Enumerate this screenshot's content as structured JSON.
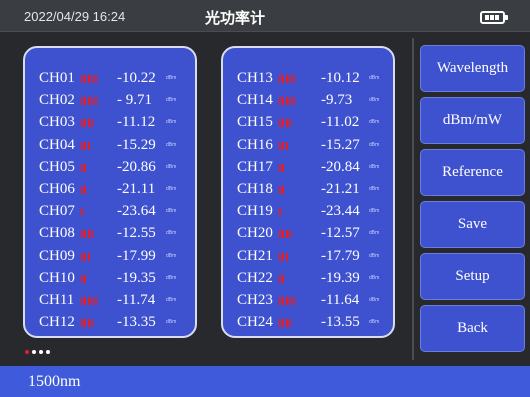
{
  "header": {
    "datetime": "2022/04/29  16:24",
    "title": "光功率计",
    "battery_icon": "battery-full-icon"
  },
  "channels": [
    {
      "name": "CH01",
      "value": "-10.22",
      "unit": "dBm",
      "level": 5
    },
    {
      "name": "CH02",
      "value": "- 9.71",
      "unit": "dBm",
      "level": 5
    },
    {
      "name": "CH03",
      "value": "-11.12",
      "unit": "dBm",
      "level": 4
    },
    {
      "name": "CH04",
      "value": "-15.29",
      "unit": "dBm",
      "level": 3
    },
    {
      "name": "CH05",
      "value": "-20.86",
      "unit": "dBm",
      "level": 2
    },
    {
      "name": "CH06",
      "value": "-21.11",
      "unit": "dBm",
      "level": 2
    },
    {
      "name": "CH07",
      "value": "-23.64",
      "unit": "dBm",
      "level": 1
    },
    {
      "name": "CH08",
      "value": "-12.55",
      "unit": "dBm",
      "level": 4
    },
    {
      "name": "CH09",
      "value": "-17.99",
      "unit": "dBm",
      "level": 3
    },
    {
      "name": "CH10",
      "value": "-19.35",
      "unit": "dBm",
      "level": 2
    },
    {
      "name": "CH11",
      "value": "-11.74",
      "unit": "dBm",
      "level": 5
    },
    {
      "name": "CH12",
      "value": "-13.35",
      "unit": "dBm",
      "level": 4
    },
    {
      "name": "CH13",
      "value": "-10.12",
      "unit": "dBm",
      "level": 5
    },
    {
      "name": "CH14",
      "value": "-9.73",
      "unit": "dBm",
      "level": 5
    },
    {
      "name": "CH15",
      "value": "-11.02",
      "unit": "dBm",
      "level": 4
    },
    {
      "name": "CH16",
      "value": "-15.27",
      "unit": "dBm",
      "level": 3
    },
    {
      "name": "CH17",
      "value": "-20.84",
      "unit": "dBm",
      "level": 2
    },
    {
      "name": "CH18",
      "value": "-21.21",
      "unit": "dBm",
      "level": 2
    },
    {
      "name": "CH19",
      "value": "-23.44",
      "unit": "dBm",
      "level": 1
    },
    {
      "name": "CH20",
      "value": "-12.57",
      "unit": "dBm",
      "level": 4
    },
    {
      "name": "CH21",
      "value": "-17.79",
      "unit": "dBm",
      "level": 3
    },
    {
      "name": "CH22",
      "value": "-19.39",
      "unit": "dBm",
      "level": 2
    },
    {
      "name": "CH23",
      "value": "-11.64",
      "unit": "dBm",
      "level": 5
    },
    {
      "name": "CH24",
      "value": "-13.55",
      "unit": "dBm",
      "level": 4
    }
  ],
  "sidebar": {
    "buttons": [
      {
        "id": "wavelength",
        "label": "Wavelength"
      },
      {
        "id": "unit",
        "label": "dBm/mW"
      },
      {
        "id": "reference",
        "label": "Reference"
      },
      {
        "id": "save",
        "label": "Save"
      },
      {
        "id": "setup",
        "label": "Setup"
      },
      {
        "id": "back",
        "label": "Back"
      }
    ]
  },
  "pager": {
    "pages": 4,
    "active": 1
  },
  "status": {
    "wavelength": "1500nm"
  },
  "colors": {
    "background": "#27292c",
    "panel": "#3e52cf",
    "signal_bar": "#e01f2c",
    "status_bar": "#3f5bdc"
  }
}
